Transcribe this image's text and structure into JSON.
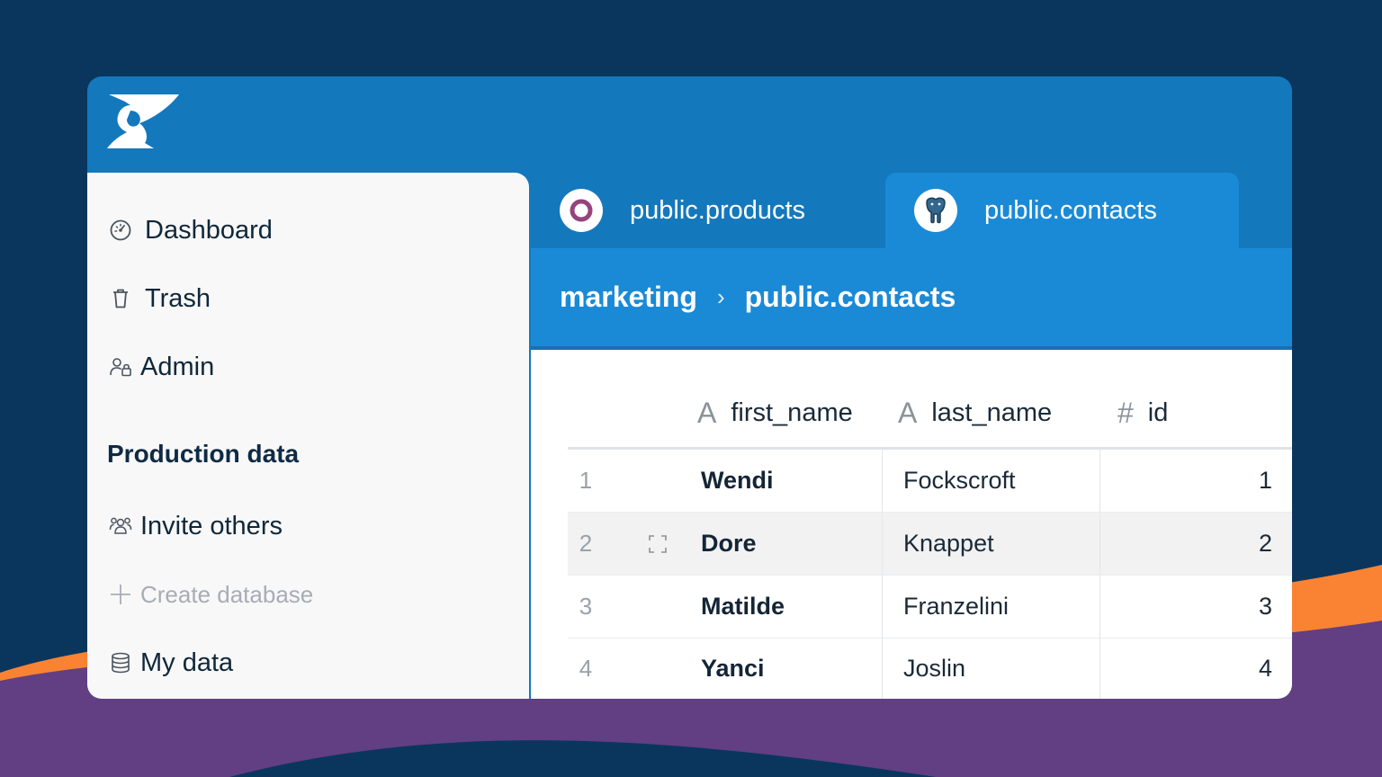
{
  "colors": {
    "background": "#0a365e",
    "app_header": "#1478bc",
    "active_tab": "#1a8ad6",
    "wave_orange": "#f98332",
    "wave_purple": "#613f82"
  },
  "sidebar": {
    "items": [
      {
        "label": "Dashboard",
        "icon": "gauge-icon"
      },
      {
        "label": "Trash",
        "icon": "trash-icon"
      },
      {
        "label": "Admin",
        "icon": "users-lock-icon"
      }
    ],
    "section_title": "Production data",
    "section_items": [
      {
        "label": "Invite others",
        "icon": "users-icon"
      },
      {
        "label": "Create database",
        "icon": "plus-icon"
      },
      {
        "label": "My data",
        "icon": "database-icon"
      }
    ]
  },
  "tabs": [
    {
      "label": "public.products",
      "icon": "ring-icon",
      "active": false
    },
    {
      "label": "public.contacts",
      "icon": "postgres-elephant-icon",
      "active": true
    }
  ],
  "breadcrumb": {
    "parent": "marketing",
    "separator": "›",
    "current": "public.contacts"
  },
  "table": {
    "columns": [
      {
        "label": "first_name",
        "type_icon": "A"
      },
      {
        "label": "last_name",
        "type_icon": "A"
      },
      {
        "label": "id",
        "type_icon": "#"
      }
    ],
    "rows": [
      {
        "num": "1",
        "first_name": "Wendi",
        "last_name": "Fockscroft",
        "id": "1",
        "highlighted": false
      },
      {
        "num": "2",
        "first_name": "Dore",
        "last_name": "Knappet",
        "id": "2",
        "highlighted": true
      },
      {
        "num": "3",
        "first_name": "Matilde",
        "last_name": "Franzelini",
        "id": "3",
        "highlighted": false
      },
      {
        "num": "4",
        "first_name": "Yanci",
        "last_name": "Joslin",
        "id": "4",
        "highlighted": false
      }
    ]
  }
}
